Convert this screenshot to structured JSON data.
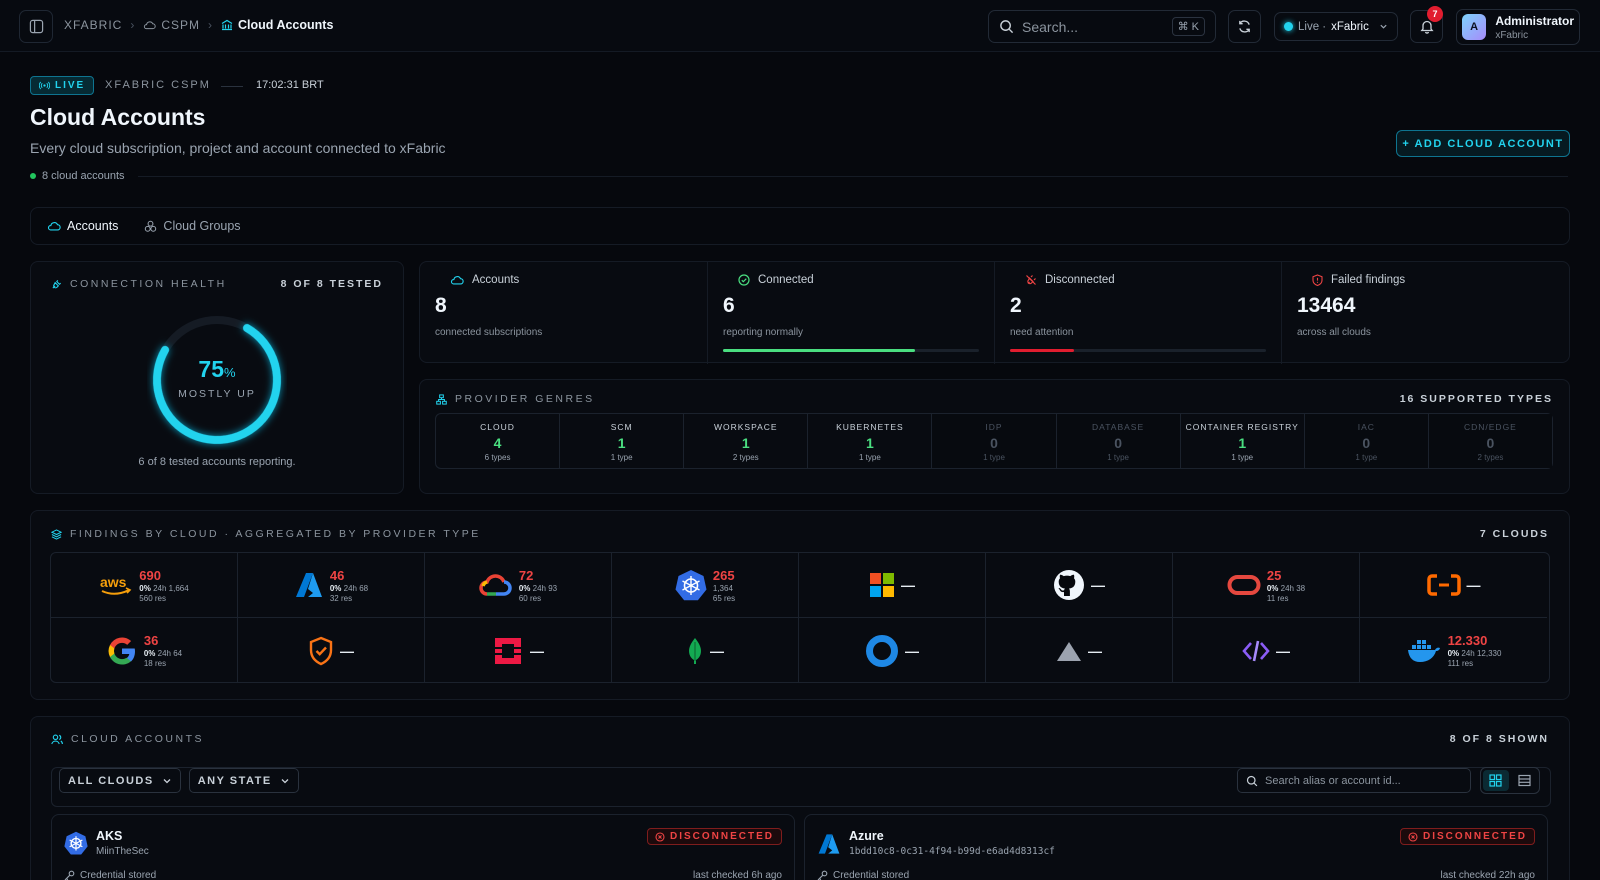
{
  "breadcrumbs": {
    "root": "XFABRIC",
    "section": "CSPM",
    "current": "Cloud Accounts"
  },
  "search": {
    "placeholder": "Search...",
    "shortcut": "⌘ K"
  },
  "env": {
    "status": "Live ·",
    "name": "xFabric"
  },
  "notifications": {
    "count": "7"
  },
  "user": {
    "initial": "A",
    "name": "Administrator",
    "org": "xFabric"
  },
  "header": {
    "live_badge": "LIVE",
    "product": "XFABRIC CSPM",
    "time": "17:02:31 BRT",
    "title": "Cloud Accounts",
    "subtitle": "Every cloud subscription, project and account connected to xFabric",
    "count": "8 cloud accounts",
    "add_button": "+ ADD CLOUD ACCOUNT"
  },
  "tabs": [
    {
      "label": "Accounts"
    },
    {
      "label": "Cloud Groups"
    }
  ],
  "health": {
    "label": "CONNECTION HEALTH",
    "tested": "8 OF 8 TESTED",
    "percent": "75",
    "percent_sign": "%",
    "percent_value": 75,
    "state": "MOSTLY UP",
    "summary": "6 of 8 tested accounts reporting."
  },
  "stats": [
    {
      "label": "Accounts",
      "value": "8",
      "sub": "connected subscriptions"
    },
    {
      "label": "Connected",
      "value": "6",
      "sub": "reporting normally",
      "fraction": 0.75
    },
    {
      "label": "Disconnected",
      "value": "2",
      "sub": "need attention",
      "fraction": 0.25
    },
    {
      "label": "Failed findings",
      "value": "13464",
      "sub": "across all clouds"
    }
  ],
  "genres": {
    "label": "PROVIDER GENRES",
    "supported": "16 SUPPORTED TYPES",
    "items": [
      {
        "name": "CLOUD",
        "count": "4",
        "types": "6 types"
      },
      {
        "name": "SCM",
        "count": "1",
        "types": "1 type"
      },
      {
        "name": "WORKSPACE",
        "count": "1",
        "types": "2 types"
      },
      {
        "name": "KUBERNETES",
        "count": "1",
        "types": "1 type"
      },
      {
        "name": "IDP",
        "count": "0",
        "types": "1 type"
      },
      {
        "name": "DATABASE",
        "count": "0",
        "types": "1 type"
      },
      {
        "name": "CONTAINER REGISTRY",
        "count": "1",
        "types": "1 type"
      },
      {
        "name": "IAC",
        "count": "0",
        "types": "1 type"
      },
      {
        "name": "CDN/EDGE",
        "count": "0",
        "types": "2 types"
      }
    ]
  },
  "findings": {
    "label": "FINDINGS BY CLOUD · AGGREGATED BY PROVIDER TYPE",
    "clouds": "7 CLOUDS",
    "cells": [
      {
        "icon": "aws-icon",
        "value": "690",
        "pct": "0%",
        "delta": "24h  1,664",
        "res": "560 res"
      },
      {
        "icon": "azure-icon",
        "value": "46",
        "pct": "0%",
        "delta": "24h  68",
        "res": "32 res"
      },
      {
        "icon": "gcp-icon",
        "value": "72",
        "pct": "0%",
        "delta": "24h  93",
        "res": "60 res"
      },
      {
        "icon": "kubernetes-icon",
        "value": "265",
        "pct": "",
        "delta": "1,364",
        "res": "65 res"
      },
      {
        "icon": "microsoft-icon",
        "value": "—"
      },
      {
        "icon": "github-icon",
        "value": "—"
      },
      {
        "icon": "oracle-icon",
        "value": "25",
        "pct": "0%",
        "delta": "24h  38",
        "res": "11 res"
      },
      {
        "icon": "alibaba-icon",
        "value": "—"
      },
      {
        "icon": "google-icon",
        "value": "36",
        "pct": "0%",
        "delta": "24h  64",
        "res": "18 res"
      },
      {
        "icon": "shield-check-icon",
        "value": "—"
      },
      {
        "icon": "openstack-icon",
        "value": "—"
      },
      {
        "icon": "mongodb-icon",
        "value": "—"
      },
      {
        "icon": "okta-icon",
        "value": "—"
      },
      {
        "icon": "vercel-icon",
        "value": "—"
      },
      {
        "icon": "code-icon",
        "value": "—"
      },
      {
        "icon": "docker-icon",
        "value": "12.330",
        "pct": "0%",
        "delta": "24h  12,330",
        "res": "111 res"
      }
    ]
  },
  "accounts": {
    "label": "CLOUD ACCOUNTS",
    "shown": "8 OF 8 SHOWN",
    "filter_cloud": "ALL CLOUDS",
    "filter_state": "ANY STATE",
    "search_placeholder": "Search alias or account id...",
    "cards": [
      {
        "name": "AKS",
        "id": "MiinTheSec",
        "status": "DISCONNECTED",
        "cred": "Credential stored",
        "checked": "last checked 6h ago"
      },
      {
        "name": "Azure",
        "id": "1bdd10c8-0c31-4f94-b99d-e6ad4d8313cf",
        "status": "DISCONNECTED",
        "cred": "Credential stored",
        "checked": "last checked 22h ago"
      }
    ]
  },
  "colors": {
    "accent": "#22d3ee",
    "danger": "#ef4444",
    "success": "#4ade80"
  }
}
